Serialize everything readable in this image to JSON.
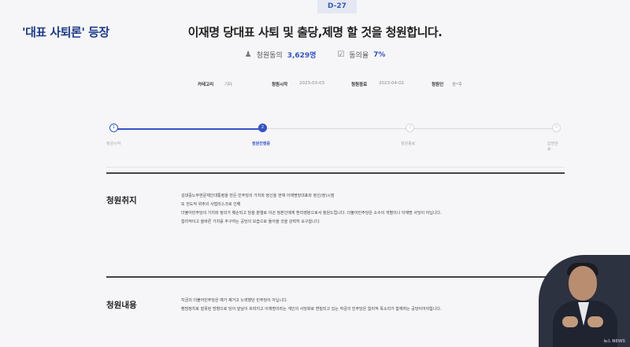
{
  "caption": "'대표 사퇴론' 등장",
  "badge": "D-27",
  "title": "이재명 당대표 사퇴 및 출당,제명 할 것을 청원합니다.",
  "stats": {
    "participants_label": "청원동의",
    "participants_value": "3,629명",
    "rate_label": "동의율",
    "rate_value": "7%"
  },
  "info": {
    "category_label": "카테고리",
    "category_value": "기타",
    "start_label": "청원시작",
    "start_value": "2023-03-03",
    "end_label": "청원종료",
    "end_value": "2023-04-02",
    "author_label": "청원인",
    "author_value": "윤*후"
  },
  "steps": [
    {
      "num": "1",
      "label": "청원시작"
    },
    {
      "num": "2",
      "label": "청원진행중"
    },
    {
      "num": "3",
      "label": "청원종료"
    },
    {
      "num": "4",
      "label": "답변완료"
    }
  ],
  "sections": [
    {
      "title": "청원취지",
      "lines": [
        "김대중노무현문재인대통령을 만든 민주당의 가치와 정신을 현재 이재명당대표와 정신(정)시점",
        "또 전도적 위주의 사법리스크로 인해",
        "더불어민주당의 가치와 정의가 훼손되고 당을 분열로 이끈 정본인에게 환리영분으로서 청원드립니다. 더불어민주당은 소수의 개별이나 이재명 사당이 아닙니다.",
        "합리적이고 올바른 가치를 추구하는 공당의 모습으로 돌아올 것을 강력히 요구합니다."
      ]
    },
    {
      "title": "청원내용",
      "lines": [
        "지금의 더불어민주당은 예가 제거고 노력했던 민주당이 아닙니다.",
        "팬덤정치로 잘못된 방향으로 당이 앞날이 흐려지고 이재명이라는 개인의 사당화로 변질되고 있는 작금의 민주당은 합리적 목소리가 함께하는 공당이어야합니다."
      ]
    }
  ],
  "inset_logo": "뉴스 NEWS"
}
